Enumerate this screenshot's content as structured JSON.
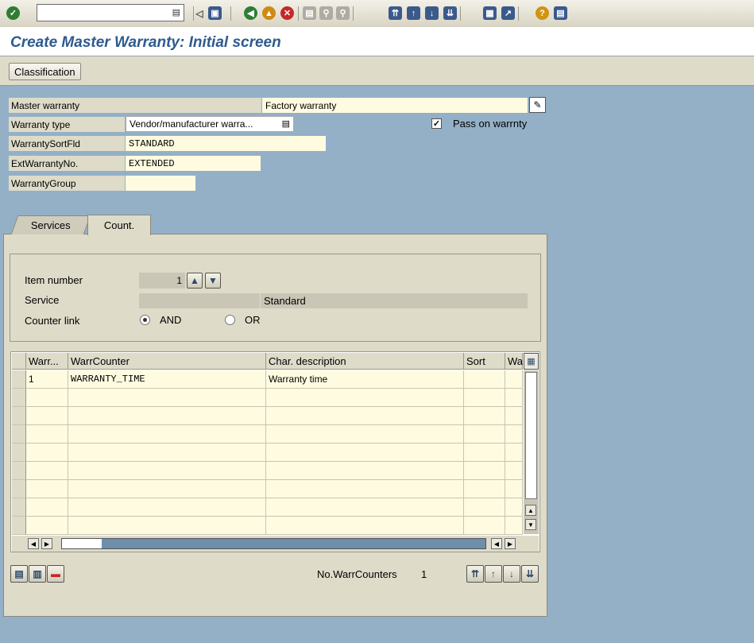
{
  "toolbar": {
    "command_field": {
      "value": "",
      "dropdown_icon": "dropdown-icon"
    },
    "buttons": [
      {
        "name": "enter-icon",
        "color": "#2f7d32"
      },
      {
        "name": "save-icon",
        "color": "#3b5a8c"
      },
      {
        "name": "back-icon",
        "color": "#2f7d32"
      },
      {
        "name": "exit-icon",
        "color": "#d08a12"
      },
      {
        "name": "cancel-icon",
        "color": "#c62828"
      },
      {
        "name": "print-icon",
        "color": "#8e8c82"
      },
      {
        "name": "find-icon",
        "color": "#8e8c82"
      },
      {
        "name": "find-next-icon",
        "color": "#8e8c82"
      },
      {
        "name": "first-page-icon",
        "color": "#3b5a8c"
      },
      {
        "name": "previous-page-icon",
        "color": "#3b5a8c"
      },
      {
        "name": "next-page-icon",
        "color": "#3b5a8c"
      },
      {
        "name": "last-page-icon",
        "color": "#3b5a8c"
      },
      {
        "name": "new-session-icon",
        "color": "#3b5a8c"
      },
      {
        "name": "shortcut-icon",
        "color": "#3b5a8c"
      },
      {
        "name": "help-icon",
        "color": "#d09412"
      },
      {
        "name": "layout-menu-icon",
        "color": "#3b5a8c"
      }
    ]
  },
  "header": {
    "title": "Create Master Warranty: Initial screen"
  },
  "app_toolbar": {
    "classification_label": "Classification"
  },
  "form": {
    "master_warranty": {
      "label": "Master warranty",
      "value": "Factory warranty"
    },
    "warranty_type": {
      "label": "Warranty type",
      "value": "Vendor/manufacturer warra..."
    },
    "pass_on": {
      "label": "Pass on warrnty",
      "checked": true
    },
    "sort_field": {
      "label": "WarrantySortFld",
      "value": "STANDARD"
    },
    "ext_no": {
      "label": "ExtWarrantyNo.",
      "value": "EXTENDED"
    },
    "group": {
      "label": "WarrantyGroup",
      "value": ""
    }
  },
  "tabs": [
    {
      "label": "Services",
      "active": false
    },
    {
      "label": "Count.",
      "active": true
    }
  ],
  "counter": {
    "item_number": {
      "label": "Item number",
      "value": "1"
    },
    "service": {
      "label": "Service",
      "value": "",
      "text": "Standard"
    },
    "counter_link": {
      "label": "Counter link",
      "options": [
        "AND",
        "OR"
      ],
      "selected": "AND"
    }
  },
  "table": {
    "columns": [
      "Warr...",
      "WarrCounter",
      "Char. description",
      "Sort",
      "Wa"
    ],
    "rows": [
      [
        "1",
        "WARRANTY_TIME",
        "Warranty time",
        "",
        ""
      ],
      [
        "",
        "",
        "",
        "",
        ""
      ],
      [
        "",
        "",
        "",
        "",
        ""
      ],
      [
        "",
        "",
        "",
        "",
        ""
      ],
      [
        "",
        "",
        "",
        "",
        ""
      ],
      [
        "",
        "",
        "",
        "",
        ""
      ],
      [
        "",
        "",
        "",
        "",
        ""
      ],
      [
        "",
        "",
        "",
        "",
        ""
      ],
      [
        "",
        "",
        "",
        "",
        ""
      ]
    ]
  },
  "footer": {
    "count_label": "No.WarrCounters",
    "count_value": "1"
  }
}
